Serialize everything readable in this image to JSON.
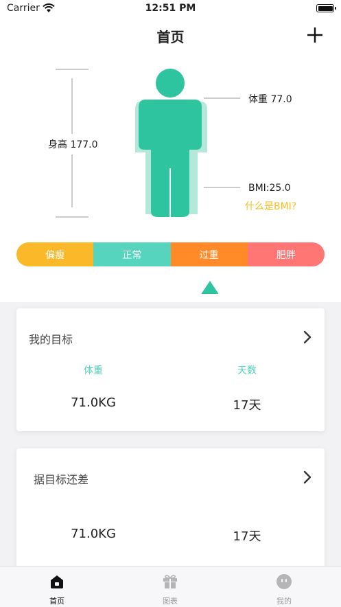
{
  "status_bar": {
    "carrier": "Carrier",
    "time": "12:51 PM"
  },
  "nav": {
    "title": "首页",
    "add_icon": "plus-icon"
  },
  "body": {
    "height_label": "身高 177.0",
    "weight_label": "体重 77.0",
    "bmi_label": "BMI:25.0",
    "what_is_bmi": "什么是BMI?"
  },
  "bmi_bar": {
    "segments": [
      {
        "label": "偏瘦",
        "color": "#fbb829"
      },
      {
        "label": "正常",
        "color": "#56d4bd"
      },
      {
        "label": "过重",
        "color": "#ff8a27"
      },
      {
        "label": "肥胖",
        "color": "#ff7674"
      }
    ],
    "indicator_color": "#2ec4a0"
  },
  "goal_card": {
    "title": "我的目标",
    "weight_label": "体重",
    "days_label": "天数",
    "weight_value": "71.0KG",
    "days_value": "17天"
  },
  "remaining_card": {
    "title": "据目标还差",
    "weight_value": "71.0KG",
    "days_value": "17天"
  },
  "tabbar": {
    "tabs": [
      {
        "label": "首页",
        "icon": "home-icon"
      },
      {
        "label": "图表",
        "icon": "gift-icon"
      },
      {
        "label": "我的",
        "icon": "face-icon"
      }
    ]
  }
}
